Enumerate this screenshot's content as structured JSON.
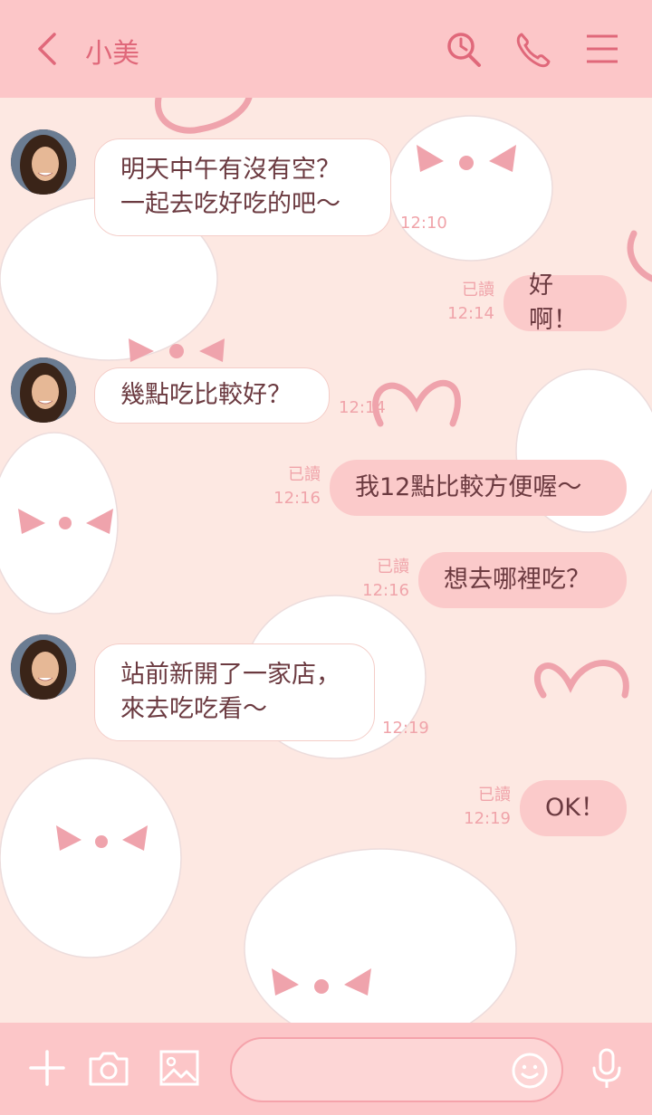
{
  "header": {
    "title": "小美",
    "back_icon": "chevron-left-icon",
    "search_icon": "search-icon",
    "call_icon": "phone-icon",
    "menu_icon": "menu-icon"
  },
  "messages": [
    {
      "dir": "in",
      "lines": [
        "明天中午有沒有空？",
        "一起去吃好吃的吧～"
      ],
      "time": "12:10"
    },
    {
      "dir": "out",
      "text": "好啊！",
      "read": "已讀",
      "time": "12:14"
    },
    {
      "dir": "in",
      "lines": [
        "幾點吃比較好？"
      ],
      "time": "12:14"
    },
    {
      "dir": "out",
      "text": "我12點比較方便喔～",
      "read": "已讀",
      "time": "12:16"
    },
    {
      "dir": "out",
      "text": "想去哪裡吃？",
      "read": "已讀",
      "time": "12:16"
    },
    {
      "dir": "in",
      "lines": [
        "站前新開了一家店，",
        "來去吃吃看～"
      ],
      "time": "12:19"
    },
    {
      "dir": "out",
      "text": "OK！",
      "read": "已讀",
      "time": "12:19"
    }
  ],
  "footer": {
    "add_icon": "plus-icon",
    "camera_icon": "camera-icon",
    "image_icon": "image-icon",
    "input_placeholder": "",
    "emoji_icon": "smiley-icon",
    "mic_icon": "microphone-icon"
  },
  "colors": {
    "header_bg": "#fcc6c8",
    "chat_bg": "#fde8e2",
    "accent": "#e0687a",
    "bubble_out": "#fbcaca",
    "bubble_in": "#ffffff",
    "text": "#6b3a40",
    "meta": "#f0a4aa"
  }
}
